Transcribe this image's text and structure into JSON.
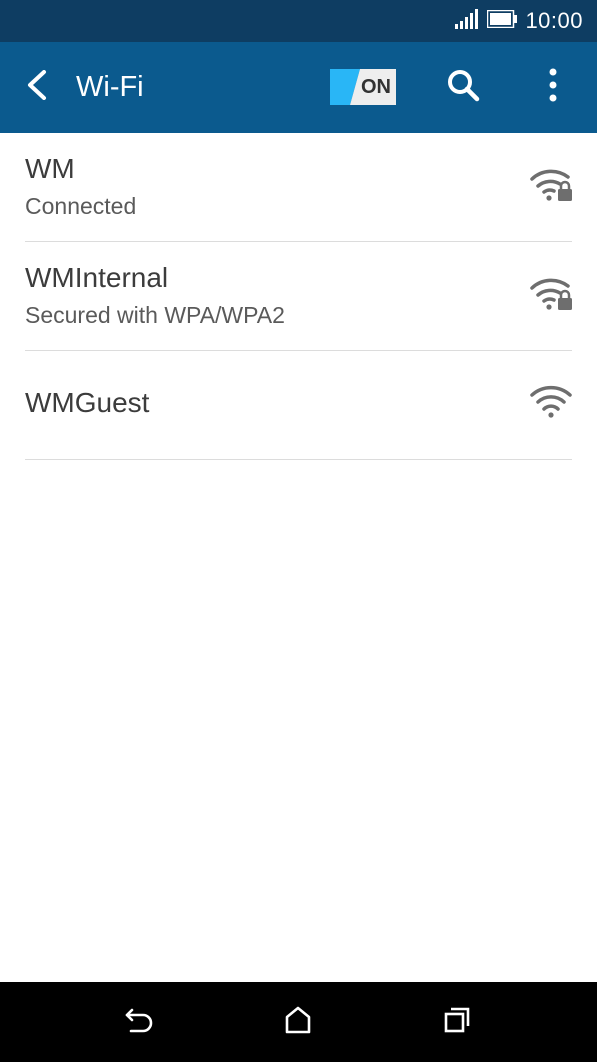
{
  "status_bar": {
    "time": "10:00",
    "signal_icon": "cell-signal-icon",
    "battery_icon": "battery-icon"
  },
  "app_bar": {
    "back_icon": "back-arrow-icon",
    "title": "Wi-Fi",
    "toggle_label": "ON",
    "search_icon": "search-icon",
    "menu_icon": "overflow-menu-icon"
  },
  "networks": [
    {
      "name": "WM",
      "status": "Connected",
      "icon": "wifi-locked-icon",
      "secured": true
    },
    {
      "name": "WMInternal",
      "status": "Secured with WPA/WPA2",
      "icon": "wifi-locked-icon",
      "secured": true
    },
    {
      "name": "WMGuest",
      "status": "",
      "icon": "wifi-icon",
      "secured": false
    }
  ],
  "nav_bar": {
    "back_icon": "nav-back-icon",
    "home_icon": "home-icon",
    "recents_icon": "recent-apps-icon"
  },
  "colors": {
    "status_bar": "#0e3d62",
    "app_bar": "#0b5a8e",
    "toggle_accent": "#29b6f6",
    "text_primary": "#3c3c3c",
    "text_secondary": "#5a5a5a",
    "icon_gray": "#6e6e6e"
  }
}
